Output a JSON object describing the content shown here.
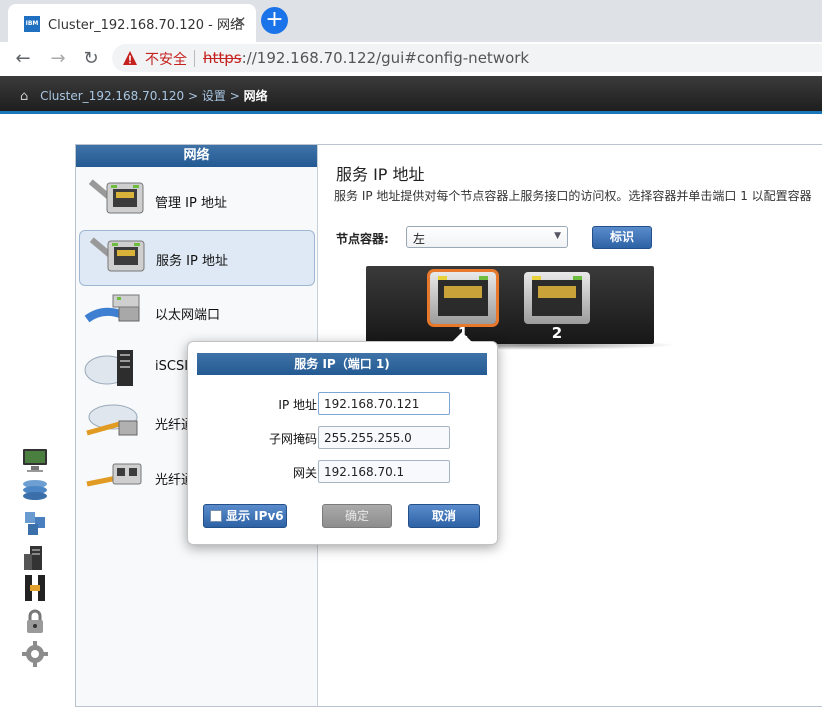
{
  "browser": {
    "tab_title": "Cluster_192.168.70.120 - 网络",
    "favicon_text": "IBM",
    "security_label": "不安全",
    "url_protocol": "https",
    "url_rest": "://192.168.70.122/gui#config-network"
  },
  "header": {
    "breadcrumb": [
      "Cluster_192.168.70.120",
      "设置",
      "网络"
    ],
    "breadcrumb_sep": ">"
  },
  "sidebar": {
    "title": "网络",
    "items": [
      {
        "label": "管理 IP 地址",
        "icon": "management-ip-icon"
      },
      {
        "label": "服务 IP 地址",
        "icon": "service-ip-icon",
        "active": true
      },
      {
        "label": "以太网端口",
        "icon": "ethernet-port-icon"
      },
      {
        "label": "iSCSI",
        "icon": "iscsi-icon"
      },
      {
        "label": "光纤通道",
        "icon": "fibre-channel-icon"
      },
      {
        "label": "光纤通道端口",
        "icon": "fibre-channel-port-icon"
      }
    ]
  },
  "content": {
    "title": "服务 IP 地址",
    "description": "服务 IP 地址提供对每个节点容器上服务接口的访问权。选择容器并单击端口 1 以配置容器",
    "node_label": "节点容器:",
    "node_value": "左",
    "identify_button": "标识",
    "ports": [
      "1",
      "2"
    ],
    "selected_port": "1"
  },
  "dialog": {
    "title": "服务 IP（端口 1)",
    "fields": [
      {
        "label": "IP 地址",
        "value": "192.168.70.121"
      },
      {
        "label": "子网掩码",
        "value": "255.255.255.0"
      },
      {
        "label": "网关",
        "value": "192.168.70.1"
      }
    ],
    "show_ipv6": "显示 IPv6",
    "ok": "确定",
    "cancel": "取消"
  },
  "colors": {
    "accent": "#2d62a5",
    "selection": "#e8782b",
    "header_bg": "#1e1e1e"
  }
}
